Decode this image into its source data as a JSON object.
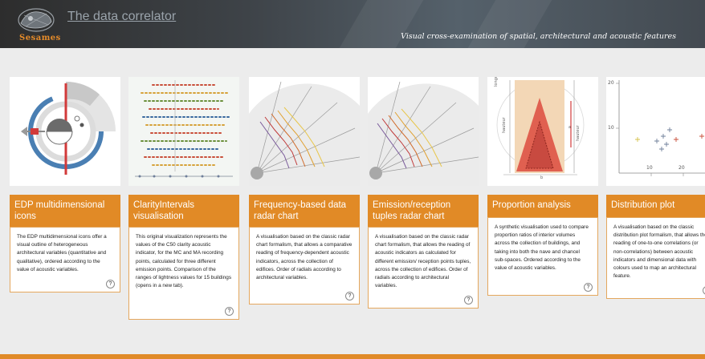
{
  "header": {
    "logo_word": "Sesames",
    "title": "The data correlator",
    "subtitle": "Visual cross-examination of spatial, architectural and acoustic features"
  },
  "colors": {
    "accent": "#e18a26",
    "header": "#3e4348",
    "background": "#ececec"
  },
  "cards": [
    {
      "title": "EDP multidimensional icons",
      "description": "The EDP multidimensional icons offer a visual outline of heterogeneous architectural variables (quantitative and qualitative), ordered according to the value of acoustic variables.",
      "help": "?"
    },
    {
      "title": "ClarityIntervals visualisation",
      "description": "This original visualization represents the values of the C50 clarity acoustic indicator, for the MC and MA recording points, calculated for three different emission points. Comparison of the ranges of lightness values for 15 buildings (opens in a new tab).",
      "help": "?"
    },
    {
      "title": "Frequency-based data radar chart",
      "description": "A visualisation based on the classic radar chart formalism, that allows a comparative reading of frequency-dependent acoustic indicators, across the collection of edifices. Order of radials according to architectural variables.",
      "help": "?"
    },
    {
      "title": "Emission/reception tuples radar chart",
      "description": "A visualisation based on the classic radar chart formalism, that allows the reading of acoustic indicators as calculated for different emission/ reception points tuples, across the collection of edifices. Order of radials according to architectural variables.",
      "help": "?"
    },
    {
      "title": "Proportion analysis",
      "description": "A synthetic visualisation used to compare proportion ratios of interior volumes across the collection of buildings, and taking into both the nave and chancel sub-spaces. Ordered according to the value of acoustic variables.",
      "help": "?"
    },
    {
      "title": "Distribution plot",
      "description": "A visualisation based on the classic distribution plot formalism, that allows the reading of one-to-one correlations (or non-correlations) between acoustic indicators and dimensional data with colours used to map an architectural feature.",
      "help": "?"
    }
  ],
  "thumb_labels": {
    "proportion_top": "longueur",
    "proportion_left": "hauteur",
    "proportion_right": "hauteur",
    "proportion_bottom": "b",
    "proportion_side": "a",
    "dist_y_20": "20",
    "dist_y_10": "10",
    "dist_x_10": "10",
    "dist_x_20": "20"
  }
}
